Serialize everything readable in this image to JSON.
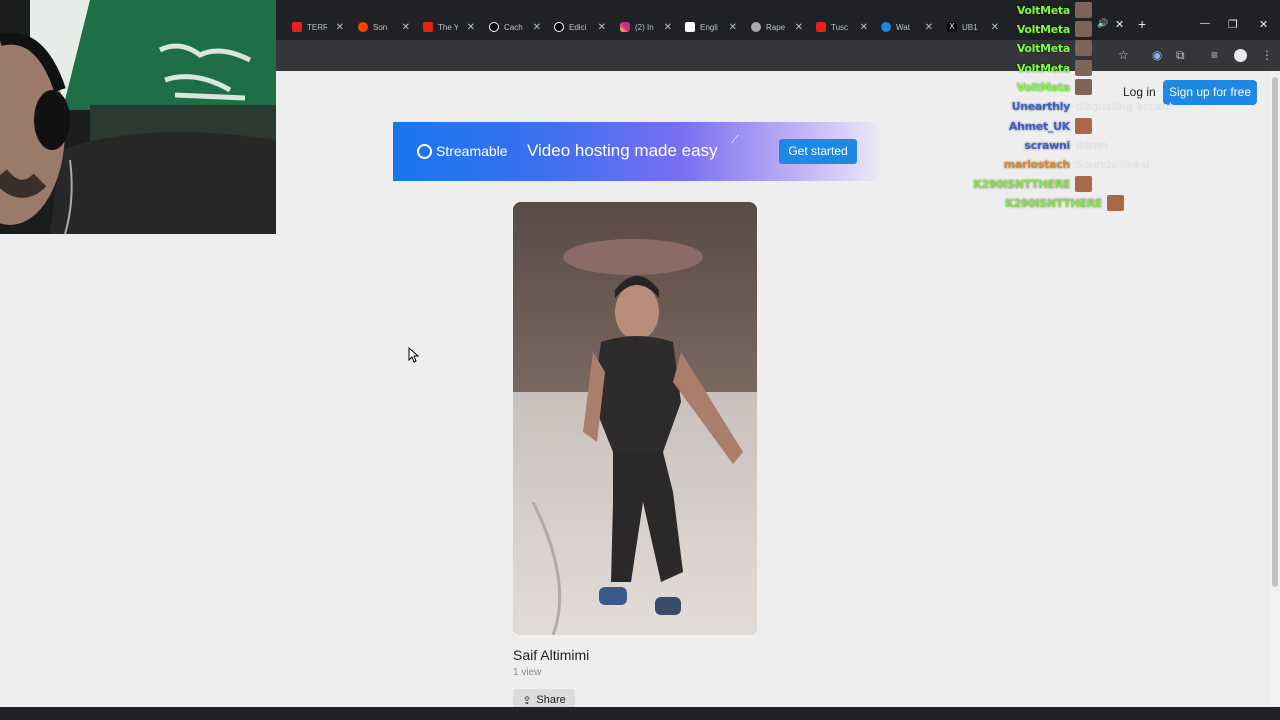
{
  "tabs": [
    {
      "title": "TERR",
      "favicon": "youtube-icon"
    },
    {
      "title": "Son",
      "favicon": "reddit-icon"
    },
    {
      "title": "The Y",
      "favicon": "youtube-icon"
    },
    {
      "title": "Cach",
      "favicon": "tiktok-icon"
    },
    {
      "title": "Edici",
      "favicon": "tiktok-icon"
    },
    {
      "title": "(2) In",
      "favicon": "instagram-icon"
    },
    {
      "title": "Engli",
      "favicon": "page-icon"
    },
    {
      "title": "Rape",
      "favicon": "globe-icon"
    },
    {
      "title": "Tusc",
      "favicon": "youtube-icon"
    },
    {
      "title": "Wat",
      "favicon": "streamable-icon"
    },
    {
      "title": "UB1",
      "favicon": "x-icon"
    }
  ],
  "window": {
    "new_tab": "+",
    "minimize": "—",
    "restore": "❐",
    "close": "✕"
  },
  "header": {
    "login": "Log in",
    "signup": "Sign up for free"
  },
  "banner": {
    "brand": "Streamable",
    "tagline": "Video hosting made easy",
    "cta": "Get started"
  },
  "video": {
    "title": "Saif Altimimi",
    "views": "1 view",
    "share": "Share"
  },
  "chat": [
    {
      "user": "VoltMeta",
      "color": "#7cfc3a",
      "text": "",
      "emote": true
    },
    {
      "user": "VoltMeta",
      "color": "#7cfc3a",
      "text": "",
      "emote": true
    },
    {
      "user": "VoltMeta",
      "color": "#7cfc3a",
      "text": "",
      "emote": true
    },
    {
      "user": "VoltMeta",
      "color": "#7cfc3a",
      "text": "",
      "emote": true
    },
    {
      "user": "VoltMeta",
      "color": "#7cfc3a",
      "text": "",
      "emote": true
    },
    {
      "user": "Unearthly",
      "color": "#3b5fcc",
      "text": "disgusting accent",
      "emote": false
    },
    {
      "user": "Ahmet_UK",
      "color": "#3b5fcc",
      "text": "",
      "emote": true
    },
    {
      "user": "scrawni",
      "color": "#3b5fcc",
      "text": "damn",
      "emote": false
    },
    {
      "user": "mariostach",
      "color": "#d98a2b",
      "text": "Sounds like u",
      "emote": false
    },
    {
      "user": "K290ISNTTHERE",
      "color": "#8ae04a",
      "text": "",
      "emote": true
    },
    {
      "user": "K290ISNTTHERE",
      "color": "#8ae04a",
      "text": "",
      "emote": true
    }
  ],
  "colors": {
    "accent": "#1e88e5",
    "chrome": "#202124",
    "page_bg": "#eeeeee"
  }
}
